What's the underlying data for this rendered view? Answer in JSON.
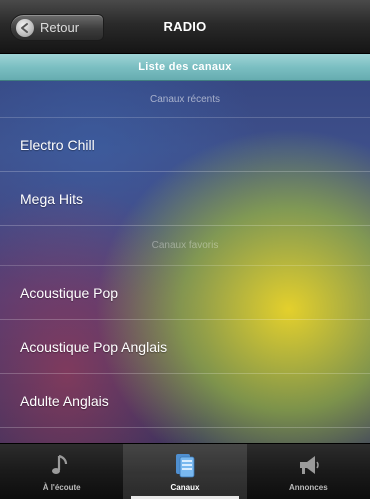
{
  "header": {
    "back_label": "Retour",
    "title": "RADIO"
  },
  "section_title": "Liste des canaux",
  "groups": [
    {
      "title": "Canaux récents",
      "channels": [
        "Electro Chill",
        "Mega Hits"
      ]
    },
    {
      "title": "Canaux favoris",
      "channels": [
        "Acoustique Pop",
        "Acoustique Pop Anglais",
        "Adulte Anglais"
      ]
    }
  ],
  "tabs": [
    {
      "label": "À l'écoute",
      "icon": "music-note-icon"
    },
    {
      "label": "Canaux",
      "icon": "channels-icon"
    },
    {
      "label": "Annonces",
      "icon": "megaphone-icon"
    }
  ],
  "active_tab": 1,
  "colors": {
    "section_bar": "#7bbfc2",
    "header": "#2a2a2a",
    "tabbar": "#1a1a1a"
  }
}
